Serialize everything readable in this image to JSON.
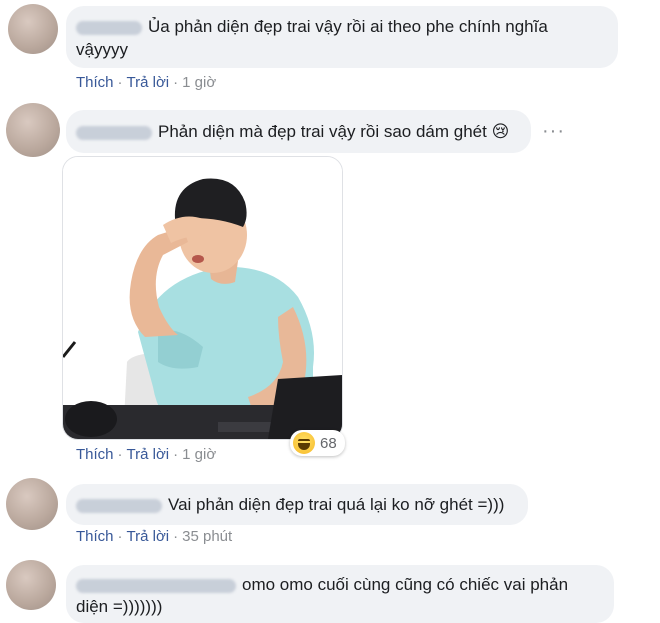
{
  "comments": [
    {
      "text_line1": "Ủa phản diện đẹp trai vậy rồi ai theo phe chính nghĩa",
      "text_line2": "vậyyyy",
      "actions": {
        "like": "Thích",
        "reply": "Trả lời",
        "time": "1 giờ"
      }
    },
    {
      "text": "Phản diện mà đẹp trai vậy rồi sao dám ghét",
      "emoji": "😢",
      "actions": {
        "like": "Thích",
        "reply": "Trả lời",
        "time": "1 giờ"
      },
      "reaction_count": "68",
      "more": "···"
    },
    {
      "text": "Vai phản diện đẹp trai quá lại ko nỡ ghét =)))",
      "actions": {
        "like": "Thích",
        "reply": "Trả lời",
        "time": "35 phút"
      }
    },
    {
      "text_line1": "omo omo cuối cùng cũng có chiếc vai phản",
      "text_line2": "diện =)))))))"
    }
  ],
  "separator": "·"
}
